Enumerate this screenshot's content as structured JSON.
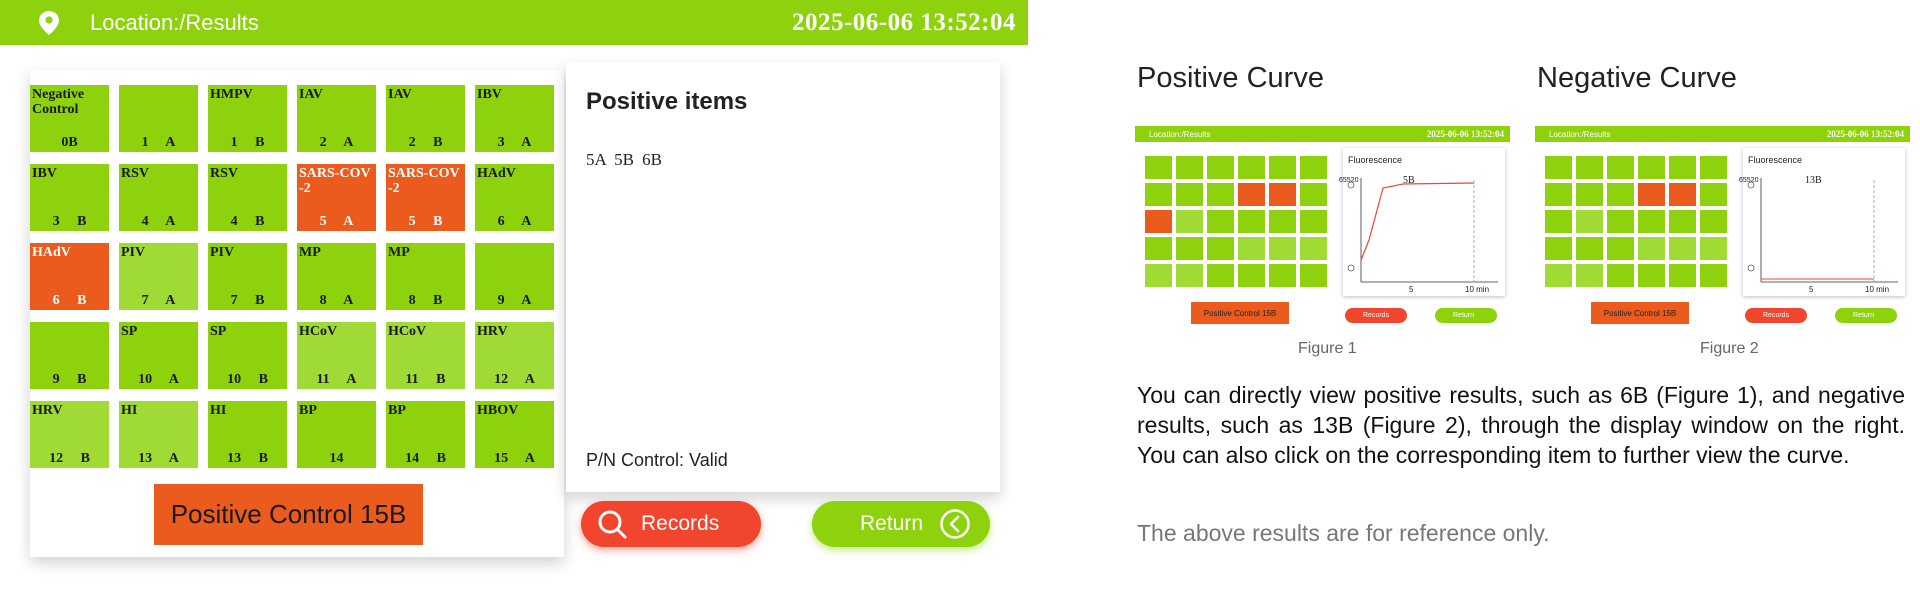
{
  "header": {
    "location": "Location:/Results",
    "datetime": "2025-06-06  13:52:04",
    "bar_color": "#8dd20c"
  },
  "grid": {
    "rows": [
      [
        {
          "name": "Negative\nControl",
          "foot": "0B",
          "color": "green"
        },
        {
          "name": "",
          "foot": "1 A",
          "color": "green"
        },
        {
          "name": "HMPV",
          "foot": "1 B",
          "color": "green"
        },
        {
          "name": "IAV",
          "foot": "2 A",
          "color": "green"
        },
        {
          "name": "IAV",
          "foot": "2 B",
          "color": "green"
        },
        {
          "name": "IBV",
          "foot": "3 A",
          "color": "green"
        }
      ],
      [
        {
          "name": "IBV",
          "foot": "3 B",
          "color": "green"
        },
        {
          "name": "RSV",
          "foot": "4 A",
          "color": "green"
        },
        {
          "name": "RSV",
          "foot": "4 B",
          "color": "green"
        },
        {
          "name": "SARS-COV\n-2",
          "foot": "5 A",
          "color": "orange"
        },
        {
          "name": "SARS-COV\n-2",
          "foot": "5 B",
          "color": "orange"
        },
        {
          "name": "HAdV",
          "foot": "6 A",
          "color": "green"
        }
      ],
      [
        {
          "name": "HAdV",
          "foot": "6 B",
          "color": "orange"
        },
        {
          "name": "PIV",
          "foot": "7 A",
          "color": "light"
        },
        {
          "name": "PIV",
          "foot": "7 B",
          "color": "green"
        },
        {
          "name": "MP",
          "foot": "8 A",
          "color": "green"
        },
        {
          "name": "MP",
          "foot": "8 B",
          "color": "green"
        },
        {
          "name": "",
          "foot": "9 A",
          "color": "green"
        }
      ],
      [
        {
          "name": "",
          "foot": "9 B",
          "color": "green"
        },
        {
          "name": "SP",
          "foot": "10 A",
          "color": "green"
        },
        {
          "name": "SP",
          "foot": "10 B",
          "color": "green"
        },
        {
          "name": "HCoV",
          "foot": "11 A",
          "color": "light"
        },
        {
          "name": "HCoV",
          "foot": "11 B",
          "color": "light"
        },
        {
          "name": "HRV",
          "foot": "12 A",
          "color": "light"
        }
      ],
      [
        {
          "name": "HRV",
          "foot": "12 B",
          "color": "light"
        },
        {
          "name": "HI",
          "foot": "13 A",
          "color": "light"
        },
        {
          "name": "HI",
          "foot": "13 B",
          "color": "green"
        },
        {
          "name": "BP",
          "foot": "14",
          "color": "green"
        },
        {
          "name": "BP",
          "foot": "14 B",
          "color": "green"
        },
        {
          "name": "HBOV",
          "foot": "15 A",
          "color": "green"
        }
      ]
    ],
    "positive_control": "Positive Control 15B"
  },
  "items_panel": {
    "title": "Positive items",
    "items": "5A  5B  6B",
    "pn_control": "P/N Control: Valid"
  },
  "buttons": {
    "records": "Records",
    "return": "Return"
  },
  "figures": [
    {
      "heading": "Positive Curve",
      "caption": "Figure 1",
      "bar_location": "Location:/Results",
      "bar_datetime": "2025-06-06  13:52:04",
      "window_title": "Fluorescence",
      "y_max": "65520",
      "well_label": "5B",
      "x_ticks": [
        "5",
        "10 min"
      ],
      "control_label": "Positive Control 15B",
      "records": "Records",
      "return": "Return",
      "highlight": "6B"
    },
    {
      "heading": "Negative Curve",
      "caption": "Figure 2",
      "bar_location": "Location:/Results",
      "bar_datetime": "2025-06-06  13:52:04",
      "window_title": "Fluorescence",
      "y_max": "65520",
      "well_label": "13B",
      "x_ticks": [
        "5",
        "10 min"
      ],
      "control_label": "Positive Control 15B",
      "records": "Records",
      "return": "Return",
      "highlight": "13B"
    }
  ],
  "description": "You can directly view positive results, such as 6B (Figure 1), and negative results, such as 13B (Figure 2), through the display window on the right. You can also click on the corresponding item to further view the curve.",
  "note": "The above results are for reference only.",
  "colors": {
    "green": "#8dd20c",
    "light_green": "#9fdb34",
    "orange": "#ea5b1d",
    "red": "#f1452d"
  }
}
